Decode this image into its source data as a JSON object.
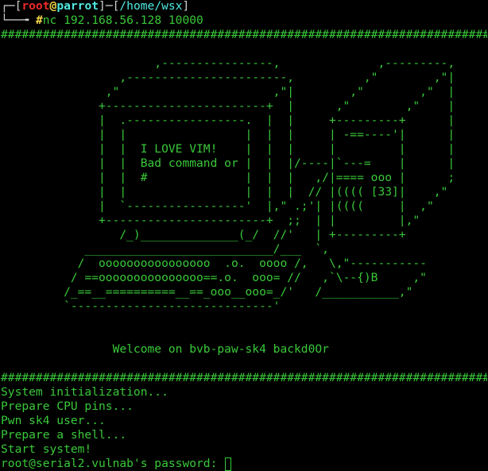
{
  "prompt": {
    "frame_open": "┌─[",
    "user": "root",
    "at": "@",
    "host": "parrot",
    "sep": "]─[",
    "path": "/home/wsx",
    "frame_close": "]",
    "frame2": "└──╼ ",
    "symbol": "#",
    "command": "nc 192.168.56.128 10000"
  },
  "banner": {
    "separator": "#################################################################################################",
    "art": [
      "",
      "                      ,----------------,              ,---------,",
      "                 ,-----------------------,          ,\"        ,\"|",
      "               ,\"                      ,\"|        ,\"        ,\"  |",
      "              +-----------------------+  |      ,\"        ,\"    |",
      "              |  .-----------------.  |  |     +---------+      |",
      "              |  |                 |  |  |     | -==----'|      |",
      "              |  |  I LOVE VIM!    |  |  |     |         |      |",
      "              |  |  Bad command or |  |  |/----|`---=    |      |",
      "              |  |  #              |  |  |   ,/|==== ooo |      ;",
      "              |  |                 |  |  |  // |(((( [33]|    ,\"",
      "              |  `-----------------'  |,\" .;'| |((((     |  ,\"",
      "              +-----------------------+  ;;  | |         |,\"",
      "                 /_)______________(_/  //'   | +---------+",
      "            ___________________________/___  `,",
      "           /  oooooooooooooooo  .o.  oooo /,   \\,\"-----------",
      "          / ==ooooooooooooooo==.o.  ooo= //   ,`\\--{)B     ,\"",
      "         /_==__==========__==_ooo__ooo=_/'   /___________,\"",
      "         `-----------------------------'",
      "",
      "",
      "                Welcome on bvb-paw-sk4 backd0Or",
      ""
    ]
  },
  "boot": {
    "lines": [
      "System initialization...",
      "Prepare CPU pins...",
      "Pwn sk4 user...",
      "Prepare a shell...",
      "Start system!"
    ],
    "password_prompt": "root@serial2.vulnab's password: "
  },
  "colors": {
    "background": "#000000",
    "terminal_green": "#39c839",
    "prompt_red": "#ef2929",
    "prompt_yellow": "#f5d84a",
    "prompt_cyan": "#4ee9e0",
    "frame_gray": "#d0d0d0"
  }
}
